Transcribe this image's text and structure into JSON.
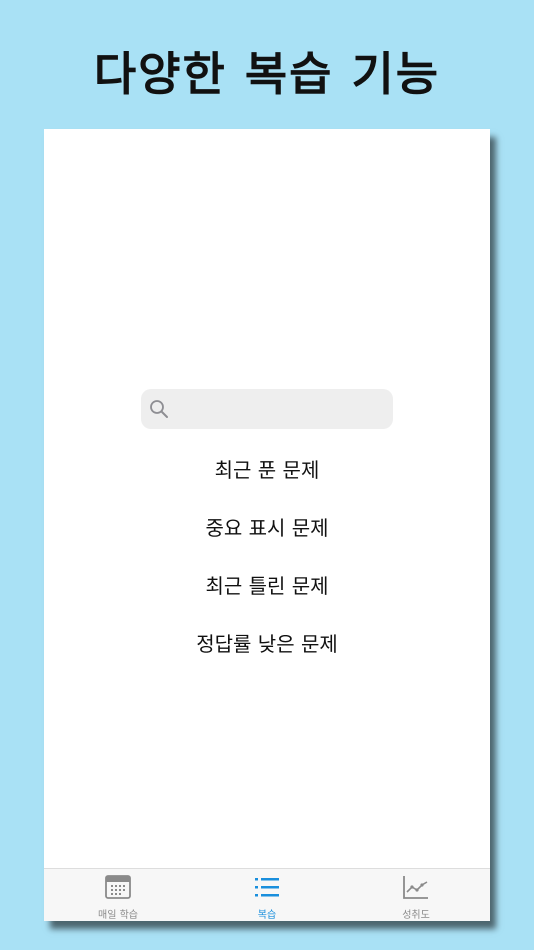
{
  "promo": {
    "headline": "다양한 복습 기능"
  },
  "search": {
    "placeholder": "",
    "value": "",
    "icon": "search-icon"
  },
  "review_menu": {
    "items": [
      {
        "label": "최근 푼 문제"
      },
      {
        "label": "중요 표시 문제"
      },
      {
        "label": "최근 틀린 문제"
      },
      {
        "label": "정답률 낮은 문제"
      }
    ]
  },
  "tabbar": {
    "tabs": [
      {
        "label": "매일 학습",
        "icon": "calendar-icon",
        "active": false
      },
      {
        "label": "복습",
        "icon": "list-icon",
        "active": true
      },
      {
        "label": "성취도",
        "icon": "line-chart-icon",
        "active": false
      }
    ]
  },
  "colors": {
    "background": "#a9e1f5",
    "accent": "#1a8fdd",
    "inactive": "#8a8a8a"
  }
}
